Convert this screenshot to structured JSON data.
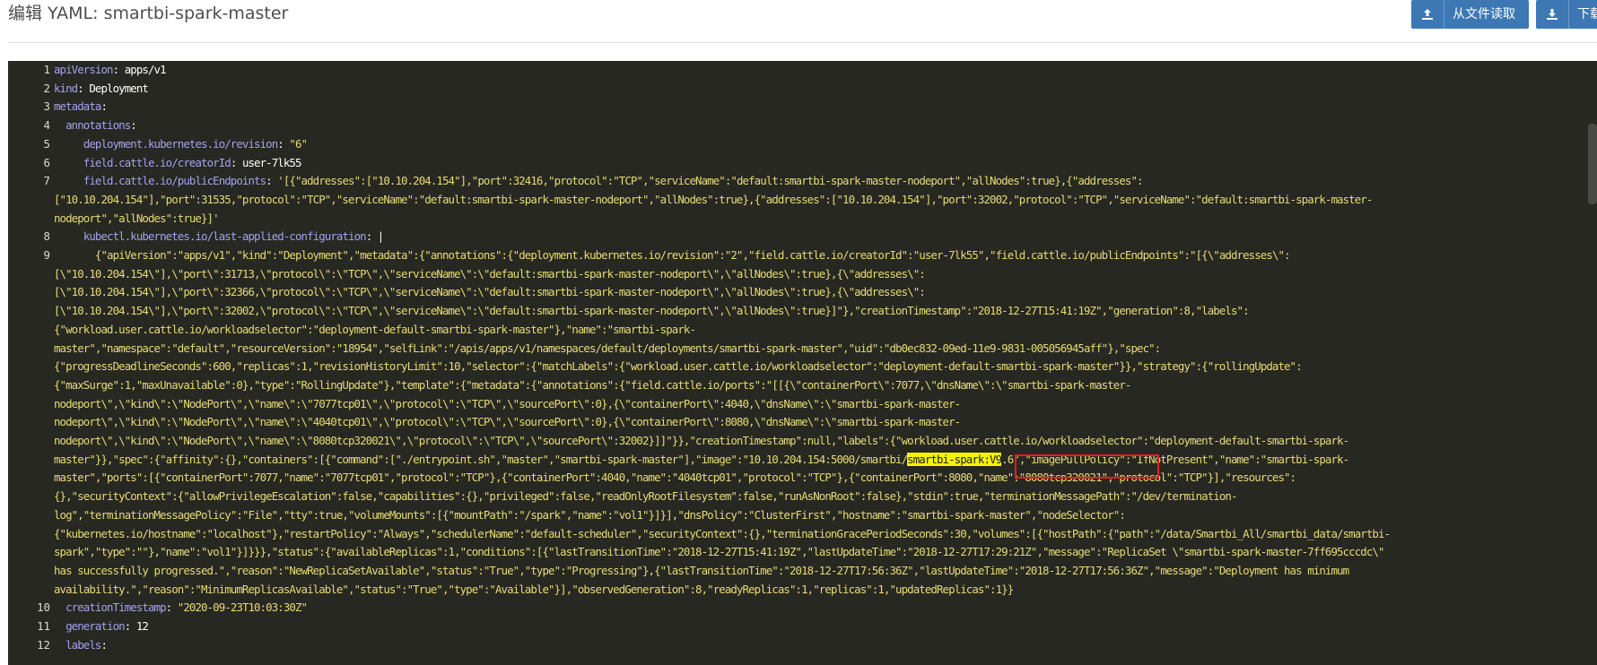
{
  "header": {
    "title": "编辑 YAML: smartbi-spark-master",
    "buttons": {
      "read_file": "从文件读取",
      "download": "下载"
    }
  },
  "editor": {
    "line_numbers": [
      "1",
      "2",
      "3",
      "4",
      "5",
      "6",
      "7",
      "8",
      "9",
      "10",
      "11",
      "12"
    ],
    "lines": [
      {
        "ln": "1",
        "parts": [
          [
            "k",
            "apiVersion"
          ],
          [
            "p",
            ": "
          ],
          [
            "n",
            "apps/v1"
          ]
        ]
      },
      {
        "ln": "2",
        "parts": [
          [
            "k",
            "kind"
          ],
          [
            "p",
            ": "
          ],
          [
            "n",
            "Deployment"
          ]
        ]
      },
      {
        "ln": "3",
        "parts": [
          [
            "k",
            "metadata"
          ],
          [
            "p",
            ":"
          ]
        ]
      },
      {
        "ln": "4",
        "parts": [
          [
            "p",
            "  "
          ],
          [
            "k",
            "annotations"
          ],
          [
            "p",
            ":"
          ]
        ]
      },
      {
        "ln": "5",
        "parts": [
          [
            "p",
            "     "
          ],
          [
            "k",
            "deployment.kubernetes.io/revision"
          ],
          [
            "p",
            ": "
          ],
          [
            "s",
            "\"6\""
          ]
        ]
      },
      {
        "ln": "6",
        "parts": [
          [
            "p",
            "     "
          ],
          [
            "k",
            "field.cattle.io/creatorId"
          ],
          [
            "p",
            ": "
          ],
          [
            "n",
            "user-7lk55"
          ]
        ]
      },
      {
        "ln": "7",
        "parts": [
          [
            "p",
            "     "
          ],
          [
            "k",
            "field.cattle.io/publicEndpoints"
          ],
          [
            "p",
            ": "
          ],
          [
            "s",
            "'[{\"addresses\":[\"10.10.204.154\"],\"port\":32416,\"protocol\":\"TCP\",\"serviceName\":\"default:smartbi-spark-master-nodeport\",\"allNodes\":true},{\"addresses\":"
          ]
        ]
      },
      {
        "ln": "",
        "parts": [
          [
            "s",
            "[\"10.10.204.154\"],\"port\":31535,\"protocol\":\"TCP\",\"serviceName\":\"default:smartbi-spark-master-nodeport\",\"allNodes\":true},{\"addresses\":[\"10.10.204.154\"],\"port\":32002,\"protocol\":\"TCP\",\"serviceName\":\"default:smartbi-spark-master-"
          ]
        ]
      },
      {
        "ln": "",
        "parts": [
          [
            "s",
            "nodeport\",\"allNodes\":true}]'"
          ]
        ]
      },
      {
        "ln": "8",
        "parts": [
          [
            "p",
            "     "
          ],
          [
            "k",
            "kubectl.kubernetes.io/last-applied-configuration"
          ],
          [
            "p",
            ": |"
          ]
        ]
      },
      {
        "ln": "9",
        "parts": [
          [
            "s",
            "       {\"apiVersion\":\"apps/v1\",\"kind\":\"Deployment\",\"metadata\":{\"annotations\":{\"deployment.kubernetes.io/revision\":\"2\",\"field.cattle.io/creatorId\":\"user-7lk55\",\"field.cattle.io/publicEndpoints\":\"[{\\\"addresses\\\":"
          ]
        ]
      },
      {
        "ln": "",
        "parts": [
          [
            "s",
            "[\\\"10.10.204.154\\\"],\\\"port\\\":31713,\\\"protocol\\\":\\\"TCP\\\",\\\"serviceName\\\":\\\"default:smartbi-spark-master-nodeport\\\",\\\"allNodes\\\":true},{\\\"addresses\\\":"
          ]
        ]
      },
      {
        "ln": "",
        "parts": [
          [
            "s",
            "[\\\"10.10.204.154\\\"],\\\"port\\\":32366,\\\"protocol\\\":\\\"TCP\\\",\\\"serviceName\\\":\\\"default:smartbi-spark-master-nodeport\\\",\\\"allNodes\\\":true},{\\\"addresses\\\":"
          ]
        ]
      },
      {
        "ln": "",
        "parts": [
          [
            "s",
            "[\\\"10.10.204.154\\\"],\\\"port\\\":32002,\\\"protocol\\\":\\\"TCP\\\",\\\"serviceName\\\":\\\"default:smartbi-spark-master-nodeport\\\",\\\"allNodes\\\":true}]\"},\"creationTimestamp\":\"2018-12-27T15:41:19Z\",\"generation\":8,\"labels\":"
          ]
        ]
      },
      {
        "ln": "",
        "parts": [
          [
            "s",
            "{\"workload.user.cattle.io/workloadselector\":\"deployment-default-smartbi-spark-master\"},\"name\":\"smartbi-spark-"
          ]
        ]
      },
      {
        "ln": "",
        "parts": [
          [
            "s",
            "master\",\"namespace\":\"default\",\"resourceVersion\":\"18954\",\"selfLink\":\"/apis/apps/v1/namespaces/default/deployments/smartbi-spark-master\",\"uid\":\"db0ec832-09ed-11e9-9831-005056945aff\"},\"spec\":"
          ]
        ]
      },
      {
        "ln": "",
        "parts": [
          [
            "s",
            "{\"progressDeadlineSeconds\":600,\"replicas\":1,\"revisionHistoryLimit\":10,\"selector\":{\"matchLabels\":{\"workload.user.cattle.io/workloadselector\":\"deployment-default-smartbi-spark-master\"}},\"strategy\":{\"rollingUpdate\":"
          ]
        ]
      },
      {
        "ln": "",
        "parts": [
          [
            "s",
            "{\"maxSurge\":1,\"maxUnavailable\":0},\"type\":\"RollingUpdate\"},\"template\":{\"metadata\":{\"annotations\":{\"field.cattle.io/ports\":\"[[{\\\"containerPort\\\":7077,\\\"dnsName\\\":\\\"smartbi-spark-master-"
          ]
        ]
      },
      {
        "ln": "",
        "parts": [
          [
            "s",
            "nodeport\\\",\\\"kind\\\":\\\"NodePort\\\",\\\"name\\\":\\\"7077tcp01\\\",\\\"protocol\\\":\\\"TCP\\\",\\\"sourcePort\\\":0},{\\\"containerPort\\\":4040,\\\"dnsName\\\":\\\"smartbi-spark-master-"
          ]
        ]
      },
      {
        "ln": "",
        "parts": [
          [
            "s",
            "nodeport\\\",\\\"kind\\\":\\\"NodePort\\\",\\\"name\\\":\\\"4040tcp01\\\",\\\"protocol\\\":\\\"TCP\\\",\\\"sourcePort\\\":0},{\\\"containerPort\\\":8080,\\\"dnsName\\\":\\\"smartbi-spark-master-"
          ]
        ]
      },
      {
        "ln": "",
        "parts": [
          [
            "s",
            "nodeport\\\",\\\"kind\\\":\\\"NodePort\\\",\\\"name\\\":\\\"8080tcp320021\\\",\\\"protocol\\\":\\\"TCP\\\",\\\"sourcePort\\\":32002}]]\"}},\"creationTimestamp\":null,\"labels\":{\"workload.user.cattle.io/workloadselector\":\"deployment-default-smartbi-spark-"
          ]
        ]
      },
      {
        "ln": "",
        "parts": [
          [
            "s",
            "master\"}},\"spec\":{\"affinity\":{},\"containers\":[{\"command\":[\"./entrypoint.sh\",\"master\",\"smartbi-spark-master\"],\"image\":\"10.10.204.154:5000/smartbi/"
          ],
          [
            "hl",
            "smartbi-spark:V9"
          ],
          [
            "s",
            ".6\",\"imagePullPolicy\":\"IfNotPresent\",\"name\":\"smartbi-spark-"
          ]
        ]
      },
      {
        "ln": "",
        "parts": [
          [
            "s",
            "master\",\"ports\":[{\"containerPort\":7077,\"name\":\"7077tcp01\",\"protocol\":\"TCP\"},{\"containerPort\":4040,\"name\":\"4040tcp01\",\"protocol\":\"TCP\"},{\"containerPort\":8080,\"name\":\"8080tcp320021\",\"protocol\":\"TCP\"}],\"resources\":"
          ]
        ]
      },
      {
        "ln": "",
        "parts": [
          [
            "s",
            "{},\"securityContext\":{\"allowPrivilegeEscalation\":false,\"capabilities\":{},\"privileged\":false,\"readOnlyRootFilesystem\":false,\"runAsNonRoot\":false},\"stdin\":true,\"terminationMessagePath\":\"/dev/termination-"
          ]
        ]
      },
      {
        "ln": "",
        "parts": [
          [
            "s",
            "log\",\"terminationMessagePolicy\":\"File\",\"tty\":true,\"volumeMounts\":[{\"mountPath\":\"/spark\",\"name\":\"vol1\"}]}],\"dnsPolicy\":\"ClusterFirst\",\"hostname\":\"smartbi-spark-master\",\"nodeSelector\":"
          ]
        ]
      },
      {
        "ln": "",
        "parts": [
          [
            "s",
            "{\"kubernetes.io/hostname\":\"localhost\"},\"restartPolicy\":\"Always\",\"schedulerName\":\"default-scheduler\",\"securityContext\":{},\"terminationGracePeriodSeconds\":30,\"volumes\":[{\"hostPath\":{\"path\":\"/data/Smartbi_All/smartbi_data/smartbi-"
          ]
        ]
      },
      {
        "ln": "",
        "parts": [
          [
            "s",
            "spark\",\"type\":\"\"},\"name\":\"vol1\"}]}}},\"status\":{\"availableReplicas\":1,\"conditions\":[{\"lastTransitionTime\":\"2018-12-27T15:41:19Z\",\"lastUpdateTime\":\"2018-12-27T17:29:21Z\",\"message\":\"ReplicaSet \\\"smartbi-spark-master-7ff695cccdc\\\""
          ]
        ]
      },
      {
        "ln": "",
        "parts": [
          [
            "s",
            "has successfully progressed.\",\"reason\":\"NewReplicaSetAvailable\",\"status\":\"True\",\"type\":\"Progressing\"},{\"lastTransitionTime\":\"2018-12-27T17:56:36Z\",\"lastUpdateTime\":\"2018-12-27T17:56:36Z\",\"message\":\"Deployment has minimum"
          ]
        ]
      },
      {
        "ln": "",
        "parts": [
          [
            "s",
            "availability.\",\"reason\":\"MinimumReplicasAvailable\",\"status\":\"True\",\"type\":\"Available\"}],\"observedGeneration\":8,\"readyReplicas\":1,\"replicas\":1,\"updatedReplicas\":1}}"
          ]
        ]
      },
      {
        "ln": "10",
        "parts": [
          [
            "p",
            "  "
          ],
          [
            "k",
            "creationTimestamp"
          ],
          [
            "p",
            ": "
          ],
          [
            "s",
            "\"2020-09-23T10:03:30Z\""
          ]
        ]
      },
      {
        "ln": "11",
        "parts": [
          [
            "p",
            "  "
          ],
          [
            "k",
            "generation"
          ],
          [
            "p",
            ": "
          ],
          [
            "n",
            "12"
          ]
        ]
      },
      {
        "ln": "12",
        "parts": [
          [
            "p",
            "  "
          ],
          [
            "k",
            "labels"
          ],
          [
            "p",
            ":"
          ]
        ]
      }
    ]
  },
  "annotation": {
    "highlight_text": "smartbi-spark:V9",
    "box_color": "#e02020"
  }
}
